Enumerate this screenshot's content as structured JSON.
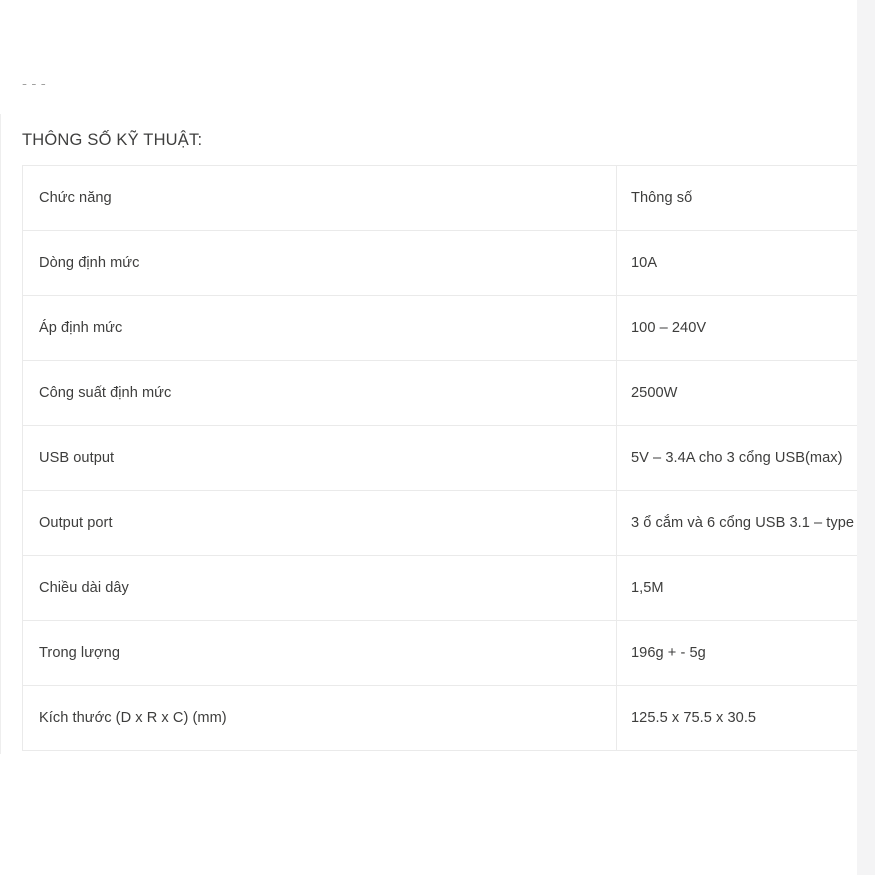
{
  "page": {
    "clipped_line_above": "- -                                                              -",
    "heading": "THÔNG SỐ KỸ THUẬT:"
  },
  "spec_table": {
    "columns": [
      "Chức năng",
      "Thông số"
    ],
    "rows": [
      {
        "label": "Chức năng",
        "value": "Thông số"
      },
      {
        "label": "Dòng định mức",
        "value": "10A"
      },
      {
        "label": "Áp định mức",
        "value": "100 – 240V"
      },
      {
        "label": "Công suất định mức",
        "value": "2500W"
      },
      {
        "label": "USB output",
        "value": "5V – 3.4A  cho 3 cổng USB(max)"
      },
      {
        "label": "Output port",
        "value": "3 ổ cắm và 6 cổng USB 3.1 – type"
      },
      {
        "label": "Chiều dài dây",
        "value": "1,5M"
      },
      {
        "label": "Trong lượng",
        "value": "196g + - 5g"
      },
      {
        "label": "Kích thước (D x R x C) (mm)",
        "value": "125.5 x 75.5 x 30.5"
      }
    ]
  },
  "colors": {
    "page_background": "#ffffff",
    "gutter": "#f4f4f5",
    "text": "#3d3d3c",
    "border": "#eaeaea"
  }
}
